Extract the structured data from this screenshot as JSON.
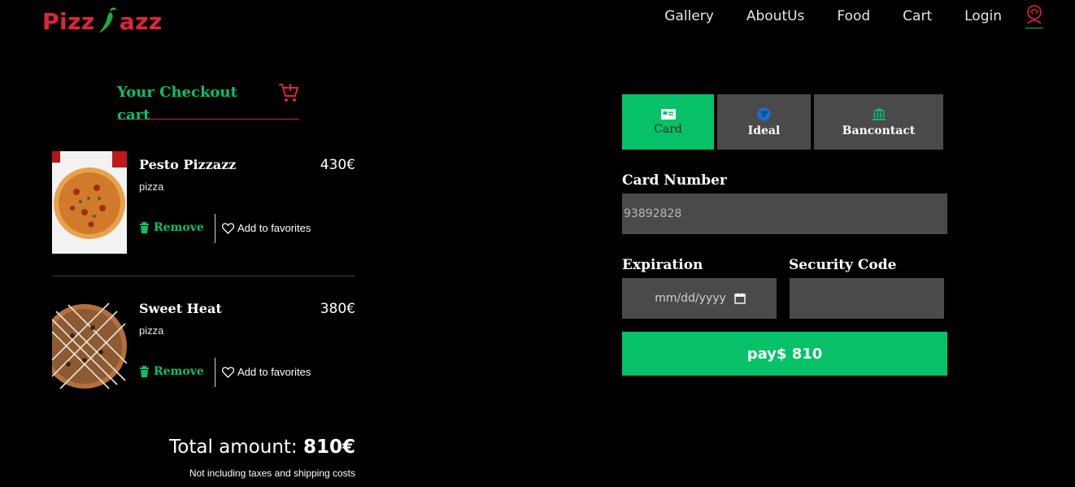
{
  "brand": {
    "name_left": "Pizz",
    "name_right": "azz"
  },
  "nav": {
    "items": [
      "Gallery",
      "AboutUs",
      "Food",
      "Cart",
      "Login"
    ]
  },
  "cart": {
    "title": "Your Checkout cart",
    "items": [
      {
        "name": "Pesto Pizzazz",
        "price": "430€",
        "category": "pizza",
        "remove_label": "Remove",
        "favorite_label": "Add to favorites"
      },
      {
        "name": "Sweet Heat",
        "price": "380€",
        "category": "pizza",
        "remove_label": "Remove",
        "favorite_label": "Add to favorites"
      }
    ],
    "total_label": "Total amount:",
    "total_value": "810€",
    "note": "Not including taxes and shipping costs"
  },
  "payment": {
    "tabs": [
      {
        "label": "Card",
        "icon": "card-icon",
        "active": true
      },
      {
        "label": "Ideal",
        "icon": "globe-icon",
        "active": false
      },
      {
        "label": "Bancontact",
        "icon": "bank-icon",
        "active": false
      }
    ],
    "card_number_label": "Card Number",
    "card_number_placeholder": "93892828",
    "expiration_label": "Expiration",
    "expiration_placeholder": "mm/dd/yyyy",
    "security_label": "Security Code",
    "pay_label": "pay$ 810"
  },
  "colors": {
    "accent": "#06c167",
    "brand": "#e0243a",
    "field": "#4a4a4a",
    "background": "#000000"
  }
}
